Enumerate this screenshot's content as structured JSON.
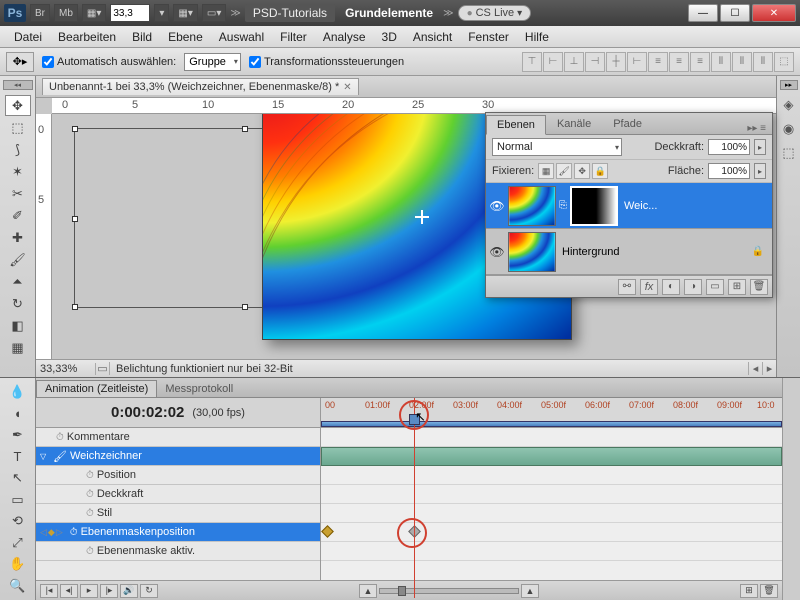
{
  "titlebar": {
    "logo": "Ps",
    "buttons": [
      "Br",
      "Mb"
    ],
    "zoom": "33,3",
    "crumbs": {
      "tutorials": "PSD-Tutorials",
      "current": "Grundelemente"
    },
    "cslive": "CS Live"
  },
  "menu": [
    "Datei",
    "Bearbeiten",
    "Bild",
    "Ebene",
    "Auswahl",
    "Filter",
    "Analyse",
    "3D",
    "Ansicht",
    "Fenster",
    "Hilfe"
  ],
  "options": {
    "auto_select": "Automatisch auswählen:",
    "group": "Gruppe",
    "transform_controls": "Transformationssteuerungen"
  },
  "document": {
    "tab": "Unbenannt-1 bei 33,3% (Weichzeichner, Ebenenmaske/8) *",
    "ruler_h": [
      "0",
      "5",
      "10",
      "15",
      "20",
      "25",
      "30"
    ],
    "ruler_v": [
      "0",
      "5"
    ]
  },
  "status": {
    "zoom": "33,33%",
    "message": "Belichtung funktioniert nur bei 32-Bit"
  },
  "layers_panel": {
    "tabs": [
      "Ebenen",
      "Kanäle",
      "Pfade"
    ],
    "blend_mode": "Normal",
    "opacity_label": "Deckkraft:",
    "opacity": "100%",
    "lock_label": "Fixieren:",
    "fill_label": "Fläche:",
    "fill": "100%",
    "layers": [
      {
        "name": "Weic...",
        "selected": true,
        "has_mask": true
      },
      {
        "name": "Hintergrund",
        "selected": false,
        "locked": true
      }
    ]
  },
  "animation": {
    "tabs": [
      "Animation (Zeitleiste)",
      "Messprotokoll"
    ],
    "timecode": "0:00:02:02",
    "fps": "(30,00 fps)",
    "ticks": [
      "00",
      "01:00f",
      "02:00f",
      "03:00f",
      "04:00f",
      "05:00f",
      "06:00f",
      "07:00f",
      "08:00f",
      "09:00f",
      "10:0"
    ],
    "tracks": {
      "comments": "Kommentare",
      "layer": "Weichzeichner",
      "position": "Position",
      "opacity": "Deckkraft",
      "style": "Stil",
      "mask_pos": "Ebenenmaskenposition",
      "mask_enable": "Ebenenmaske aktiv."
    }
  }
}
